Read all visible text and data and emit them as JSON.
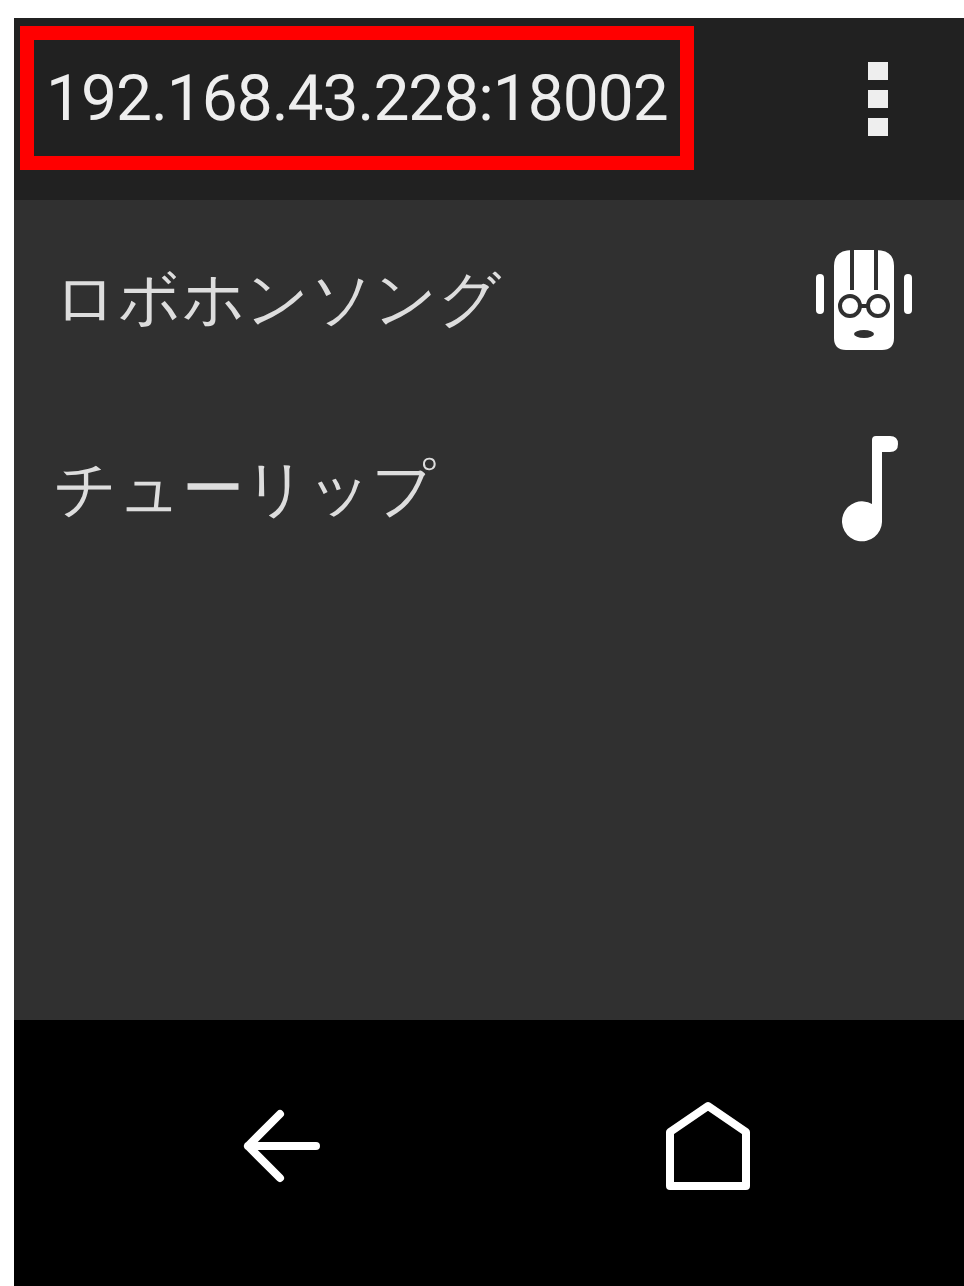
{
  "app_bar": {
    "title": "192.168.43.228:18002",
    "highlighted": true
  },
  "songs": [
    {
      "title": "ロボホンソング",
      "kind": "robot"
    },
    {
      "title": "チューリップ",
      "kind": "note"
    }
  ],
  "nav_bar": {
    "buttons": [
      {
        "kind": "back"
      },
      {
        "kind": "home"
      }
    ]
  }
}
